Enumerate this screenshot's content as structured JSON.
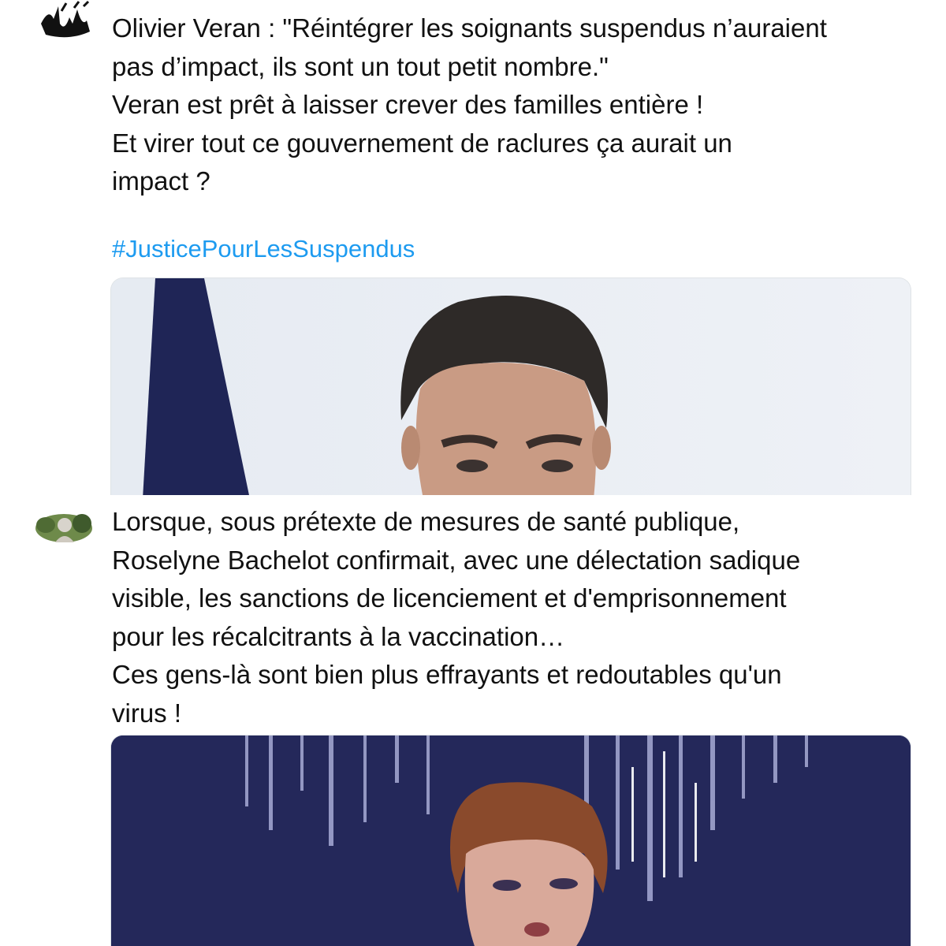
{
  "tweets": [
    {
      "avatar_icon": "black-graffiti-avatar-icon",
      "text": "Olivier Veran : \"Réintégrer les soignants suspendus n’auraient\npas d’impact, ils sont un tout petit nombre.\"\nVeran est prêt à laisser crever des familles entière !\nEt virer tout ce gouvernement de raclures ça aurait un\nimpact ?",
      "hashtag": "#JusticePourLesSuspendus",
      "media_icon": "man-portrait-photo-icon"
    },
    {
      "avatar_icon": "statue-avatar-icon",
      "text": "Lorsque, sous prétexte de mesures de santé publique,\nRoselyne Bachelot confirmait, avec une délectation sadique\nvisible, les sanctions de licenciement et d'emprisonnement\npour les récalcitrants à la vaccination…\nCes gens-là sont bien plus effrayants et redoutables qu'un\nvirus !",
      "media_icon": "woman-tv-studio-photo-icon"
    }
  ],
  "colors": {
    "hashtag": "#1d9bf0",
    "text": "#111111",
    "studio_bg": "#24285a"
  }
}
